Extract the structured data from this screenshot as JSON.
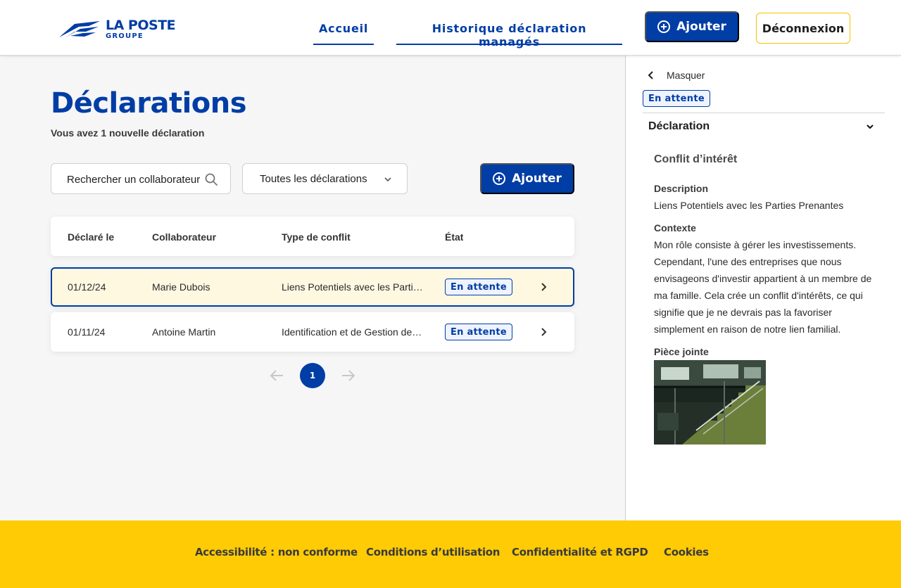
{
  "brand": {
    "name": "LA POSTE",
    "sub": "GROUPE"
  },
  "nav": [
    {
      "label": "Accueil"
    },
    {
      "label": "Historique déclaration managés"
    }
  ],
  "header": {
    "add_label": "Ajouter",
    "logout_label": "Déconnexion"
  },
  "page": {
    "title": "Déclarations",
    "subtitle": "Vous avez 1 nouvelle déclaration"
  },
  "filters": {
    "search_placeholder": "Rechercher un collaborateur",
    "select_value": "Toutes les déclarations",
    "add_label": "Ajouter"
  },
  "table": {
    "headers": [
      "Déclaré le",
      "Collaborateur",
      "Type de conflit",
      "État"
    ],
    "rows": [
      {
        "date": "01/12/24",
        "collaborator": "Marie Dubois",
        "type": "Liens Potentiels avec les Parties Prenantes",
        "status": "En attente",
        "selected": true
      },
      {
        "date": "01/11/24",
        "collaborator": "Antoine Martin",
        "type": "Identification et de Gestion des Conflits d'Intérêts",
        "status": "En attente",
        "selected": false
      }
    ]
  },
  "pagination": {
    "current": "1"
  },
  "panel": {
    "hide_label": "Masquer",
    "status": "En attente",
    "section_title": "Déclaration",
    "heading": "Conflit d’intérêt",
    "description_label": "Description",
    "description": "Liens Potentiels avec les Parties Prenantes",
    "context_label": "Contexte",
    "context": "Mon rôle consiste à gérer les investissements. Cependant, l'une des entreprises que nous envisageons d'investir appartient  à un membre de ma famille. Cela crée un conflit d'intérêts, ce qui signifie que je ne devrais pas la favoriser simplement en raison de notre lien familial.",
    "attachment_label": "Pièce jointe"
  },
  "footer": [
    {
      "label": "Accessibilité : non conforme"
    },
    {
      "label": "Conditions d’utilisation"
    },
    {
      "label": "Confidentialité et RGPD"
    },
    {
      "label": "Cookies"
    }
  ],
  "colors": {
    "primary": "#003da5",
    "accent": "#ffcb05",
    "selected_row": "#fff8e1"
  },
  "icons": [
    "logo-bird-icon",
    "plus-circle-icon",
    "search-icon",
    "chevron-down-icon",
    "chevron-right-icon",
    "chevron-left-icon",
    "arrow-left-icon",
    "arrow-right-icon"
  ]
}
